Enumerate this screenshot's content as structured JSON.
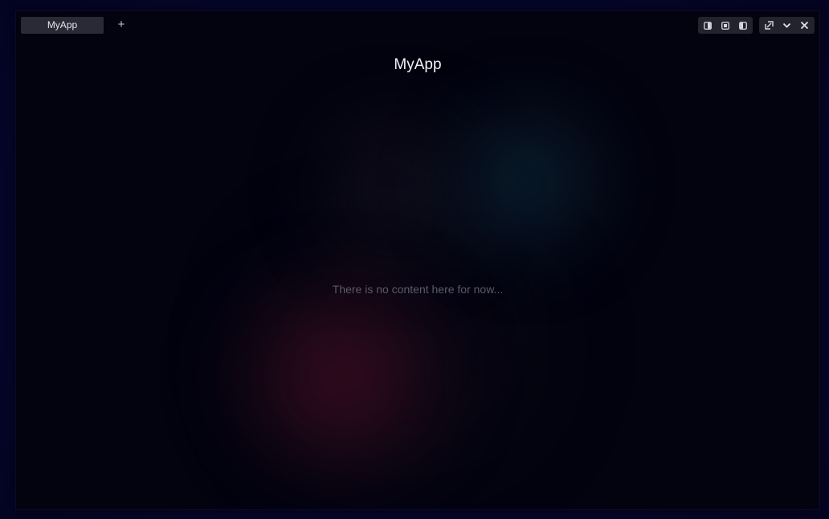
{
  "tabbar": {
    "tabs": [
      {
        "label": "MyApp",
        "active": true
      }
    ],
    "new_tab_label": "+"
  },
  "window_controls": {
    "layout_icons": [
      "split-left-icon",
      "split-center-icon",
      "split-right-icon"
    ],
    "action_icons": [
      "restore-icon",
      "minimize-icon",
      "close-icon"
    ]
  },
  "main": {
    "title": "MyApp",
    "empty_message": "There is no content here for now..."
  },
  "colors": {
    "window_bg": "#03030f",
    "desktop_bg": "#05052a",
    "tab_bg": "#2a2a36",
    "accent_red": "#46102a",
    "accent_teal": "#0e303e"
  }
}
